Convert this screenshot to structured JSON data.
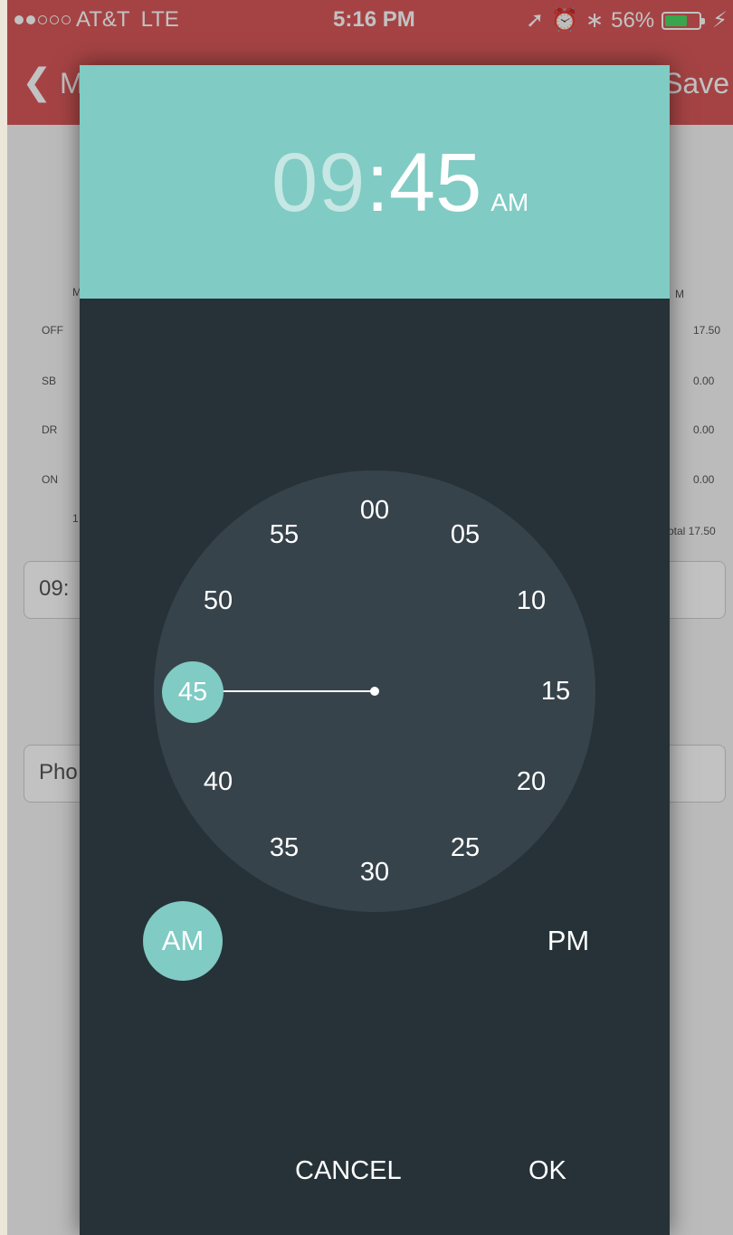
{
  "status_bar": {
    "carrier": "AT&T",
    "network": "LTE",
    "time": "5:16 PM",
    "battery_percent": "56%",
    "signal_bars_filled": 2,
    "signal_bars_total": 5,
    "icons": [
      "location-arrow-icon",
      "alarm-icon",
      "bluetooth-icon",
      "battery-icon",
      "charging-bolt-icon"
    ]
  },
  "navbar": {
    "back_label": "M",
    "action_label": "Save",
    "brand_color": "#d9585a"
  },
  "background": {
    "log_labels": [
      "OFF",
      "SB",
      "DR",
      "ON"
    ],
    "log_totals": [
      "17.50",
      "0.00",
      "0.00",
      "0.00"
    ],
    "total_label": "otal 17.50",
    "time_field": "09:",
    "phone_field": "Pho",
    "axis_left": "M",
    "axis_right": "M",
    "axis_tick": "1"
  },
  "picker": {
    "hour": "09",
    "separator": ":",
    "minute": "45",
    "period": "AM",
    "header_color": "#80cbc4",
    "body_color": "#263238",
    "clock_face_color": "#37434b",
    "minutes": [
      "00",
      "05",
      "10",
      "15",
      "20",
      "25",
      "30",
      "35",
      "40",
      "45",
      "50",
      "55"
    ],
    "selected_minute": "45",
    "am_label": "AM",
    "pm_label": "PM",
    "cancel_label": "CANCEL",
    "ok_label": "OK"
  }
}
